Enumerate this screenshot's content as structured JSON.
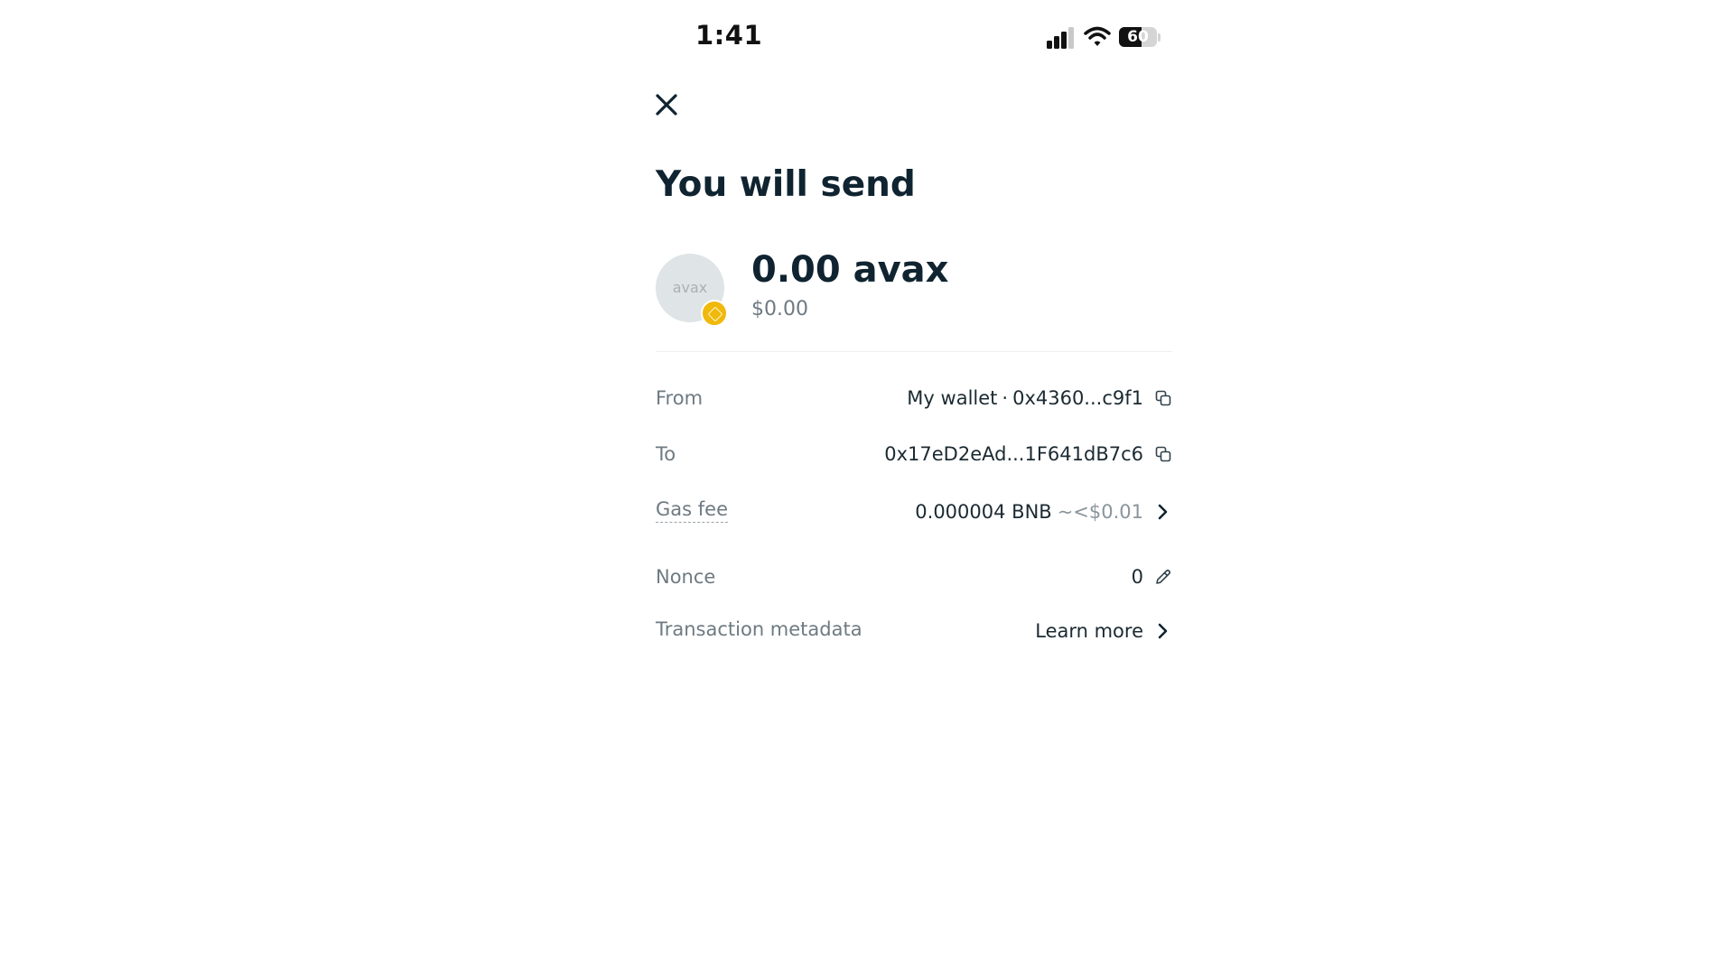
{
  "status_bar": {
    "time": "1:41",
    "battery": "60"
  },
  "header": {
    "title": "You will send"
  },
  "token": {
    "avatar_text": "avax",
    "amount": "0.00 avax",
    "fiat": "$0.00"
  },
  "details": {
    "from": {
      "label": "From",
      "wallet_name": "My wallet",
      "address": "0x4360...c9f1"
    },
    "to": {
      "label": "To",
      "address": "0x17eD2eAd...1F641dB7c6"
    },
    "gas": {
      "label": "Gas fee",
      "amount": "0.000004 BNB",
      "fiat": "~<$0.01"
    },
    "nonce": {
      "label": "Nonce",
      "value": "0"
    },
    "metadata": {
      "label": "Transaction metadata",
      "link": "Learn more"
    }
  },
  "colors": {
    "text": "#0f2430",
    "muted": "#6e7a82",
    "badge": "#f0b90b"
  }
}
